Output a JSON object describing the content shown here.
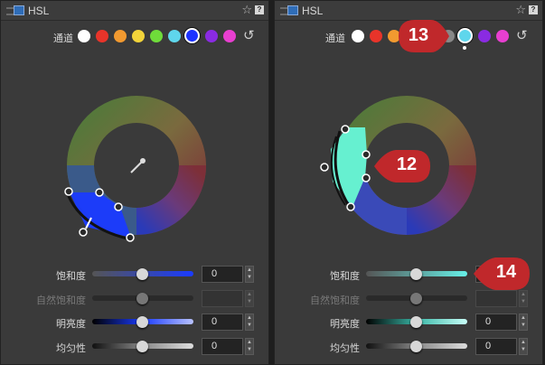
{
  "panels": [
    {
      "title": "HSL",
      "channel_label": "通道",
      "selected_channel": "blue",
      "sliders": [
        {
          "label": "饱和度",
          "value": "0",
          "disabled": false
        },
        {
          "label": "自然饱和度",
          "value": "",
          "disabled": true
        },
        {
          "label": "明亮度",
          "value": "0",
          "disabled": false
        },
        {
          "label": "均匀性",
          "value": "0",
          "disabled": false
        }
      ]
    },
    {
      "title": "HSL",
      "channel_label": "通道",
      "selected_channel": "aqua",
      "sliders": [
        {
          "label": "饱和度",
          "value": "",
          "disabled": false
        },
        {
          "label": "自然饱和度",
          "value": "",
          "disabled": true
        },
        {
          "label": "明亮度",
          "value": "0",
          "disabled": false
        },
        {
          "label": "均匀性",
          "value": "0",
          "disabled": false
        }
      ]
    }
  ],
  "channels": [
    {
      "name": "white",
      "color": "#ffffff"
    },
    {
      "name": "red",
      "color": "#e8342a"
    },
    {
      "name": "orange",
      "color": "#f29a30"
    },
    {
      "name": "yellow",
      "color": "#f2d43a"
    },
    {
      "name": "green",
      "color": "#6fdc3a"
    },
    {
      "name": "aqua",
      "color": "#5fd6ec"
    },
    {
      "name": "blue",
      "color": "#1d33ff"
    },
    {
      "name": "purple",
      "color": "#8a2be2"
    },
    {
      "name": "magenta",
      "color": "#e83fd0"
    }
  ],
  "callouts": [
    {
      "number": "13"
    },
    {
      "number": "12"
    },
    {
      "number": "14"
    }
  ],
  "icons": {
    "star": "☆",
    "help": "?",
    "reset": "↺",
    "eyedropper": "eyedropper-icon"
  },
  "colors": {
    "callout_red": "#c0282b",
    "panel_bg": "#3a3a3a"
  }
}
